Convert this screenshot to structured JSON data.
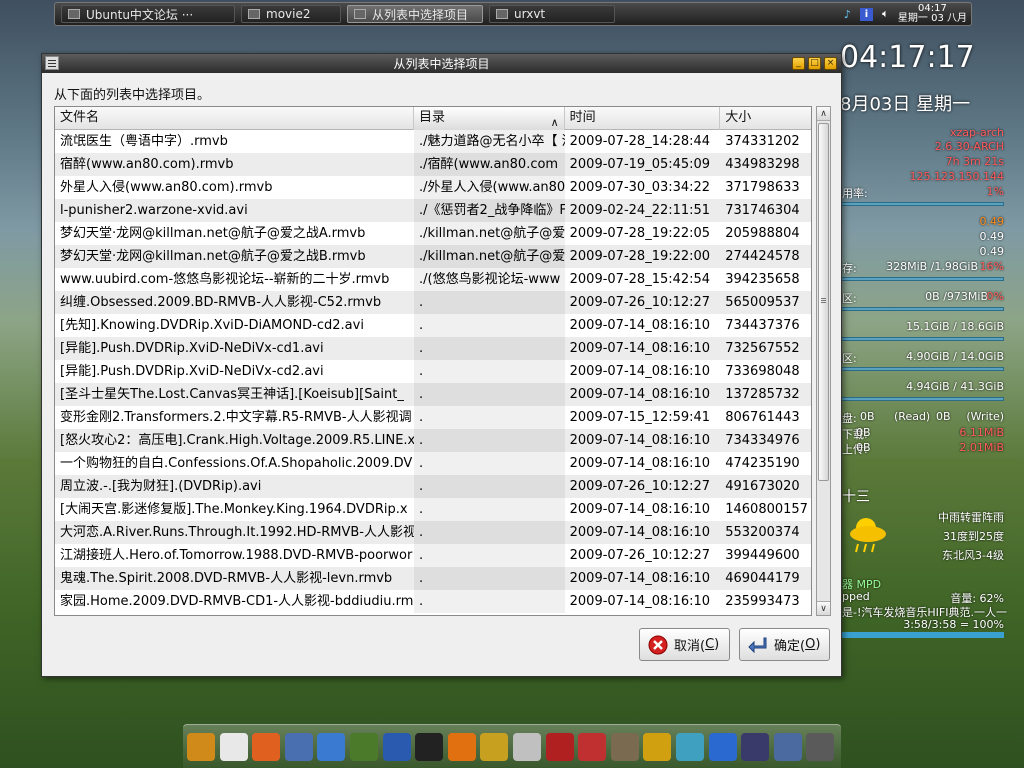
{
  "taskbar": {
    "tasks": [
      {
        "label": "Ubuntu中文论坛 ···",
        "active": false
      },
      {
        "label": "movie2",
        "active": false
      },
      {
        "label": "从列表中选择项目",
        "active": true
      },
      {
        "label": "urxvt",
        "active": false
      }
    ],
    "clock_time": "04:17",
    "clock_date": "星期一 03 八月"
  },
  "conky": {
    "time": "04:17:17",
    "date": "8月03日 星期一",
    "host": "xzap-arch",
    "kernel": "2.6.30-ARCH",
    "uptime": "7h 3m 21s",
    "ip": "125.123.150.144",
    "cpu_label": "用率:",
    "cpu_value": "1%",
    "load1": "0.49",
    "load2": "0.49",
    "load3": "0.49",
    "mem_label": "存:",
    "mem_value": "328MiB  /1.98GiB",
    "mem_pct": "16%",
    "swap_label": "区:",
    "swap_value": "0B     /973MiB",
    "swap_pct": "0%",
    "disk1": "15.1GiB / 18.6GiB",
    "disk2_label": "区:",
    "disk2": "4.90GiB / 14.0GiB",
    "disk3": "4.94GiB / 41.3GiB",
    "io_label": "盘:",
    "io_read": "0B",
    "io_read_label": "(Read)",
    "io_write": "0B",
    "io_write_label": "(Write)",
    "net_down_label": "下载:",
    "net_down": "0B",
    "net_down_total": "6.11MiB",
    "net_up_label": "上传:",
    "net_up": "0B",
    "net_up_total": "2.01MiB",
    "weather_label": "十三",
    "weather_desc": "中雨转雷阵雨",
    "weather_temp": "31度到25度",
    "weather_wind": "东北风3-4级",
    "mpd_label": "器 MPD",
    "mpd_state": "pped",
    "mpd_volume": "音量: 62%",
    "mpd_title": "是-!汽车发烧音乐HIFI典范.一人一",
    "mpd_progress": "3:58/3:58 = 100%",
    "mpd_progress_fraction": 1.0
  },
  "dialog": {
    "title": "从列表中选择项目",
    "prompt": "从下面的列表中选择项目。",
    "columns": [
      "文件名",
      "目录",
      "时间",
      "大小"
    ],
    "rows": [
      [
        "流氓医生（粤语中字）.rmvb",
        "./魅力道路@无名小卒【 流",
        "2009-07-28_14:28:44",
        "374331202"
      ],
      [
        "宿醉(www.an80.com).rmvb",
        "./宿醉(www.an80.com",
        "2009-07-19_05:45:09",
        "434983298"
      ],
      [
        "外星人入侵(www.an80.com).rmvb",
        "./外星人入侵(www.an80",
        "2009-07-30_03:34:22",
        "371798633"
      ],
      [
        "l-punisher2.warzone-xvid.avi",
        "./《惩罚者2_战争降临》F",
        "2009-02-24_22:11:51",
        "731746304"
      ],
      [
        "梦幻天堂·龙网@killman.net@航子@爱之战A.rmvb",
        "./killman.net@航子@爱之",
        "2009-07-28_19:22:05",
        "205988804"
      ],
      [
        "梦幻天堂·龙网@killman.net@航子@爱之战B.rmvb",
        "./killman.net@航子@爱之",
        "2009-07-28_19:22:00",
        "274424578"
      ],
      [
        "www.uubird.com-悠悠鸟影视论坛--崭新的二十岁.rmvb",
        "./(悠悠鸟影视论坛-www",
        "2009-07-28_15:42:54",
        "394235658"
      ],
      [
        "纠缠.Obsessed.2009.BD-RMVB-人人影视-C52.rmvb",
        ".",
        "2009-07-26_10:12:27",
        "565009537"
      ],
      [
        "[先知].Knowing.DVDRip.XviD-DiAMOND-cd2.avi",
        ".",
        "2009-07-14_08:16:10",
        "734437376"
      ],
      [
        "[异能].Push.DVDRip.XviD-NeDiVx-cd1.avi",
        ".",
        "2009-07-14_08:16:10",
        "732567552"
      ],
      [
        "[异能].Push.DVDRip.XviD-NeDiVx-cd2.avi",
        ".",
        "2009-07-14_08:16:10",
        "733698048"
      ],
      [
        "[圣斗士星矢The.Lost.Canvas冥王神话].[Koeisub][Saint_",
        ".",
        "2009-07-14_08:16:10",
        "137285732"
      ],
      [
        "变形金刚2.Transformers.2.中文字幕.R5-RMVB-人人影视调",
        ".",
        "2009-07-15_12:59:41",
        "806761443"
      ],
      [
        "[怒火攻心2：高压电].Crank.High.Voltage.2009.R5.LINE.x",
        ".",
        "2009-07-14_08:16:10",
        "734334976"
      ],
      [
        "一个购物狂的自白.Confessions.Of.A.Shopaholic.2009.DV",
        ".",
        "2009-07-14_08:16:10",
        "474235190"
      ],
      [
        "周立波.-.[我为财狂].(DVDRip).avi",
        ".",
        "2009-07-26_10:12:27",
        "491673020"
      ],
      [
        "[大闹天宫.影迷修复版].The.Monkey.King.1964.DVDRip.x",
        ".",
        "2009-07-14_08:16:10",
        "1460800157"
      ],
      [
        "大河恋.A.River.Runs.Through.It.1992.HD-RMVB-人人影视",
        ".",
        "2009-07-14_08:16:10",
        "553200374"
      ],
      [
        "江湖接班人.Hero.of.Tomorrow.1988.DVD-RMVB-poorwor",
        ".",
        "2009-07-26_10:12:27",
        "399449600"
      ],
      [
        "鬼魂.The.Spirit.2008.DVD-RMVB-人人影视-levn.rmvb",
        ".",
        "2009-07-14_08:16:10",
        "469044179"
      ],
      [
        "家园.Home.2009.DVD-RMVB-CD1-人人影视-bddiudiu.rm",
        ".",
        "2009-07-14_08:16:10",
        "235993473"
      ]
    ],
    "cancel_label": "取消(",
    "cancel_key": "C",
    "ok_label": "确定(",
    "ok_key": "O",
    "close_paren": ")"
  },
  "dock": {
    "items": [
      "file-manager-icon",
      "terminal-icon",
      "firefox-icon",
      "xfce-mouse-icon",
      "network-globe-icon",
      "book-icon",
      "google-earth-icon",
      "qq-penguin-icon",
      "basketball-icon",
      "notes-icon",
      "text-editor-icon",
      "font-viewer-icon",
      "media-player-icon",
      "gimp-icon",
      "feather-icon",
      "audio-player-icon",
      "music-note-icon",
      "video-clapper-icon",
      "virtualbox-icon",
      "calculator-icon"
    ],
    "colors": [
      "#d08a1a",
      "#e8e8e8",
      "#e06020",
      "#4a6fb0",
      "#3a7ad0",
      "#4a7a2a",
      "#2a5ab0",
      "#222",
      "#e07010",
      "#c8a020",
      "#c0c0c0",
      "#b02020",
      "#c03030",
      "#7a6a50",
      "#d0a010",
      "#40a0c0",
      "#2a6ad0",
      "#3a3a6a",
      "#4a6aa0",
      "#5a5a5a"
    ]
  },
  "colors": {
    "titlebar": "#3c3c3c",
    "accent_red": "#ff5a5a",
    "accent_orange": "#ff8c1a"
  }
}
